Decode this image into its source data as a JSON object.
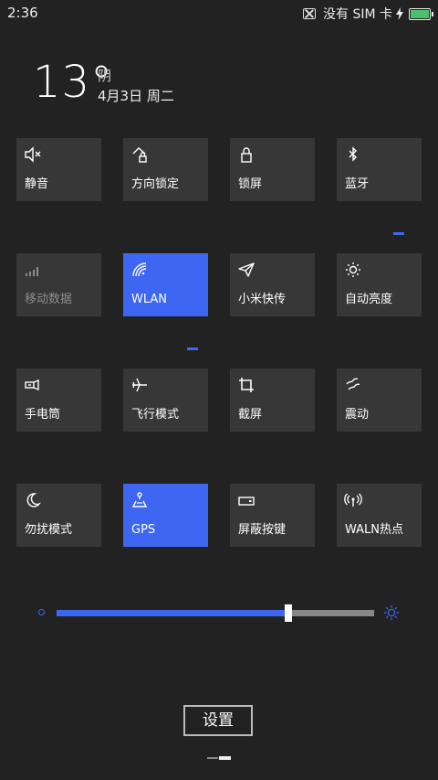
{
  "status": {
    "time": "2:36",
    "sim_text": "没有 SIM 卡"
  },
  "weather": {
    "temp": "13°",
    "condition": "阴",
    "date": "4月3日 周二"
  },
  "tiles": [
    {
      "label": "静音",
      "icon": "mute-icon",
      "active": false
    },
    {
      "label": "方向锁定",
      "icon": "rotation-lock-icon",
      "active": false
    },
    {
      "label": "锁屏",
      "icon": "lock-icon",
      "active": false
    },
    {
      "label": "蓝牙",
      "icon": "bluetooth-icon",
      "active": false
    },
    {
      "label": "移动数据",
      "icon": "mobile-data-icon",
      "active": false
    },
    {
      "label": "WLAN",
      "icon": "wifi-icon",
      "active": true
    },
    {
      "label": "小米快传",
      "icon": "paper-plane-icon",
      "active": false
    },
    {
      "label": "自动亮度",
      "icon": "auto-brightness-icon",
      "active": false
    },
    {
      "label": "手电筒",
      "icon": "flashlight-icon",
      "active": false
    },
    {
      "label": "飞行模式",
      "icon": "airplane-icon",
      "active": false
    },
    {
      "label": "截屏",
      "icon": "crop-icon",
      "active": false
    },
    {
      "label": "震动",
      "icon": "vibrate-icon",
      "active": false
    },
    {
      "label": "勿扰模式",
      "icon": "moon-icon",
      "active": false
    },
    {
      "label": "GPS",
      "icon": "gps-icon",
      "active": true
    },
    {
      "label": "屏蔽按键",
      "icon": "block-keys-icon",
      "active": false
    },
    {
      "label": "WALN热点",
      "icon": "hotspot-icon",
      "active": false
    }
  ],
  "brightness": {
    "value": 0.73
  },
  "settings_label": "设置",
  "colors": {
    "accent": "#3d66f2",
    "tile": "#373737",
    "background": "#222222"
  }
}
